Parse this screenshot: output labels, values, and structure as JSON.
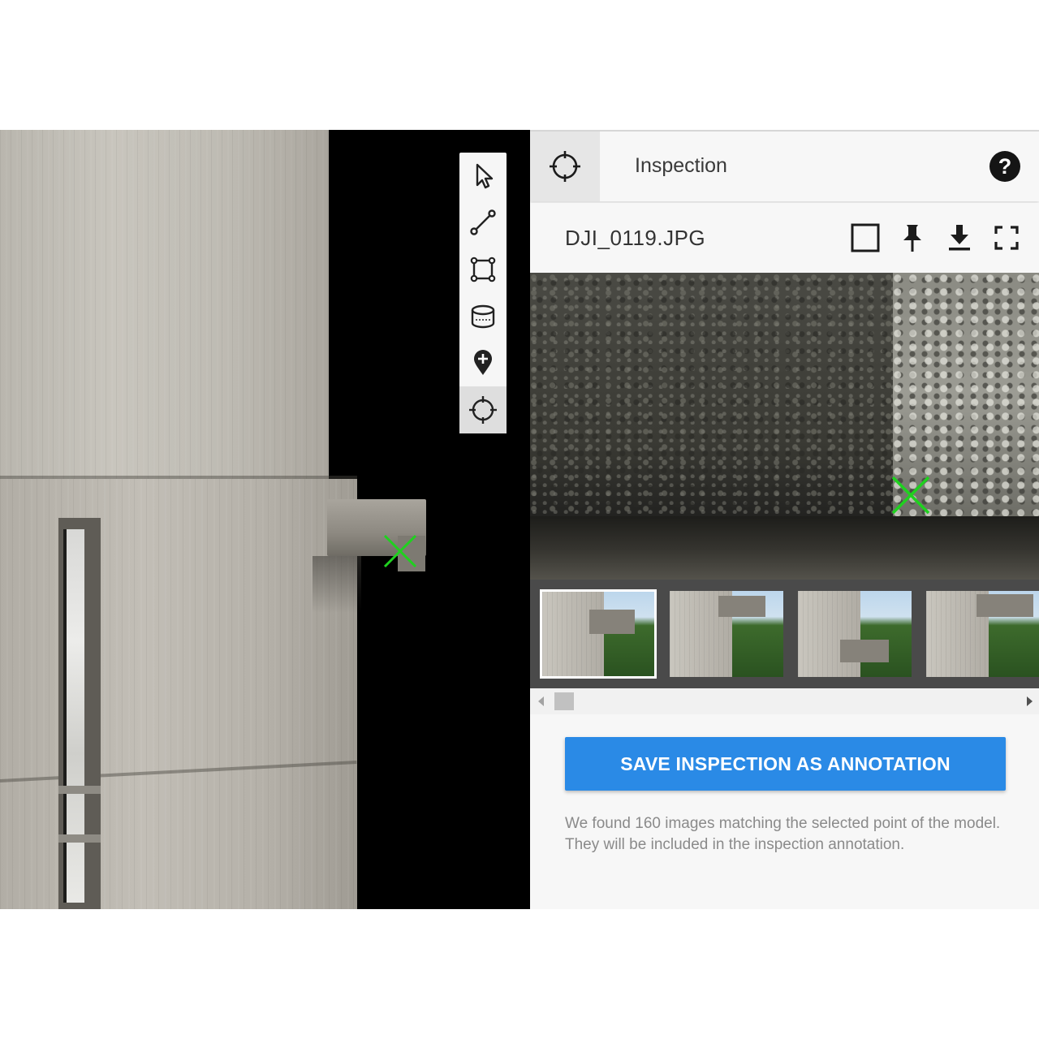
{
  "toolbar": {
    "tools": [
      {
        "name": "select",
        "icon": "cursor-arrow-icon"
      },
      {
        "name": "measure-line",
        "icon": "line-measure-icon"
      },
      {
        "name": "measure-area",
        "icon": "area-polygon-icon"
      },
      {
        "name": "measure-volume",
        "icon": "volume-cylinder-icon"
      },
      {
        "name": "add-annotation",
        "icon": "map-pin-plus-icon"
      },
      {
        "name": "inspection",
        "icon": "crosshair-icon",
        "active": true
      }
    ]
  },
  "panel": {
    "header_icon": "crosshair-icon",
    "title": "Inspection",
    "help_label": "?",
    "file": {
      "name": "DJI_0119.JPG",
      "actions": [
        "checkbox-square-icon",
        "pin-icon",
        "download-icon",
        "fullscreen-icon"
      ]
    },
    "thumbnails_visible": 4,
    "selected_thumbnail": 1,
    "save_button_label": "SAVE INSPECTION AS ANNOTATION",
    "info_text": "We found 160 images matching the selected point of the model. They will be included in the inspection annotation."
  },
  "colors": {
    "accent": "#2a8ae6",
    "marker": "#1fd11f",
    "viewport_background": "#000000",
    "panel_background": "#f7f7f7"
  }
}
